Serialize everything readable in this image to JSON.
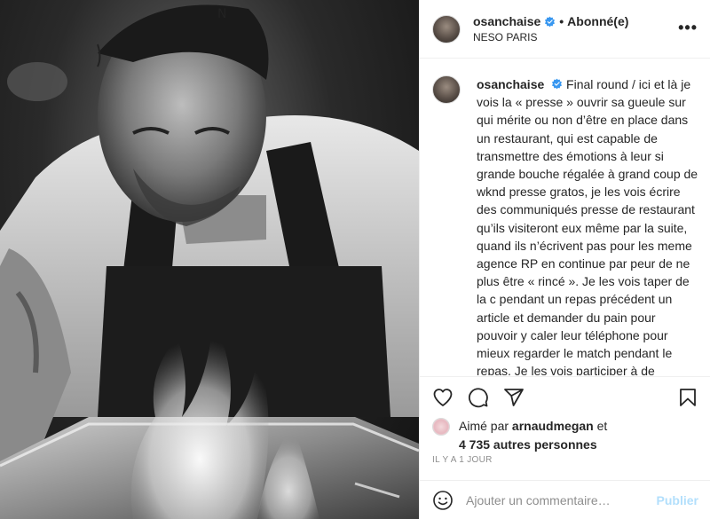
{
  "post": {
    "username": "osanchaise",
    "follow_status": "Abonné(e)",
    "separator": "•",
    "location": "NESO PARIS",
    "more_label": "•••",
    "caption_text": "Final round / ici et là je vois la « presse » ouvrir sa gueule sur qui mérite ou non d’être en place dans un restaurant, qui est capable de transmettre des émotions à leur si grande bouche régalée à grand coup de wknd presse gratos, je les vois écrire des communiqués presse de restaurant qu’ils visiteront eux même par la suite, quand ils n’écrivent pas pour les meme agence RP en continue par peur de ne plus être « rincé ». Je les vois taper de la c pendant un repas précédent un article et demander du pain pour pouvoir y caler leur téléphone pour mieux regarder le match pendant le repas. Je les vois participer à de mauvaises emissions et écrire en MP",
    "liked_by_prefix": "Aimé par",
    "liked_by_user": "arnaudmegan",
    "liked_by_suffix": "et",
    "others_count": "4 735 autres personnes",
    "timestamp": "IL Y A 1 JOUR"
  },
  "comment": {
    "placeholder": "Ajouter un commentaire…",
    "publish_label": "Publier"
  },
  "colors": {
    "verified_blue": "#3897f0",
    "publish_disabled": "#b2dffc",
    "muted_text": "#8e8e8e"
  },
  "icons": {
    "like": "heart-icon",
    "comment": "comment-icon",
    "share": "paper-plane-icon",
    "save": "bookmark-icon",
    "emoji": "smiley-icon",
    "verified": "verified-badge-icon"
  }
}
